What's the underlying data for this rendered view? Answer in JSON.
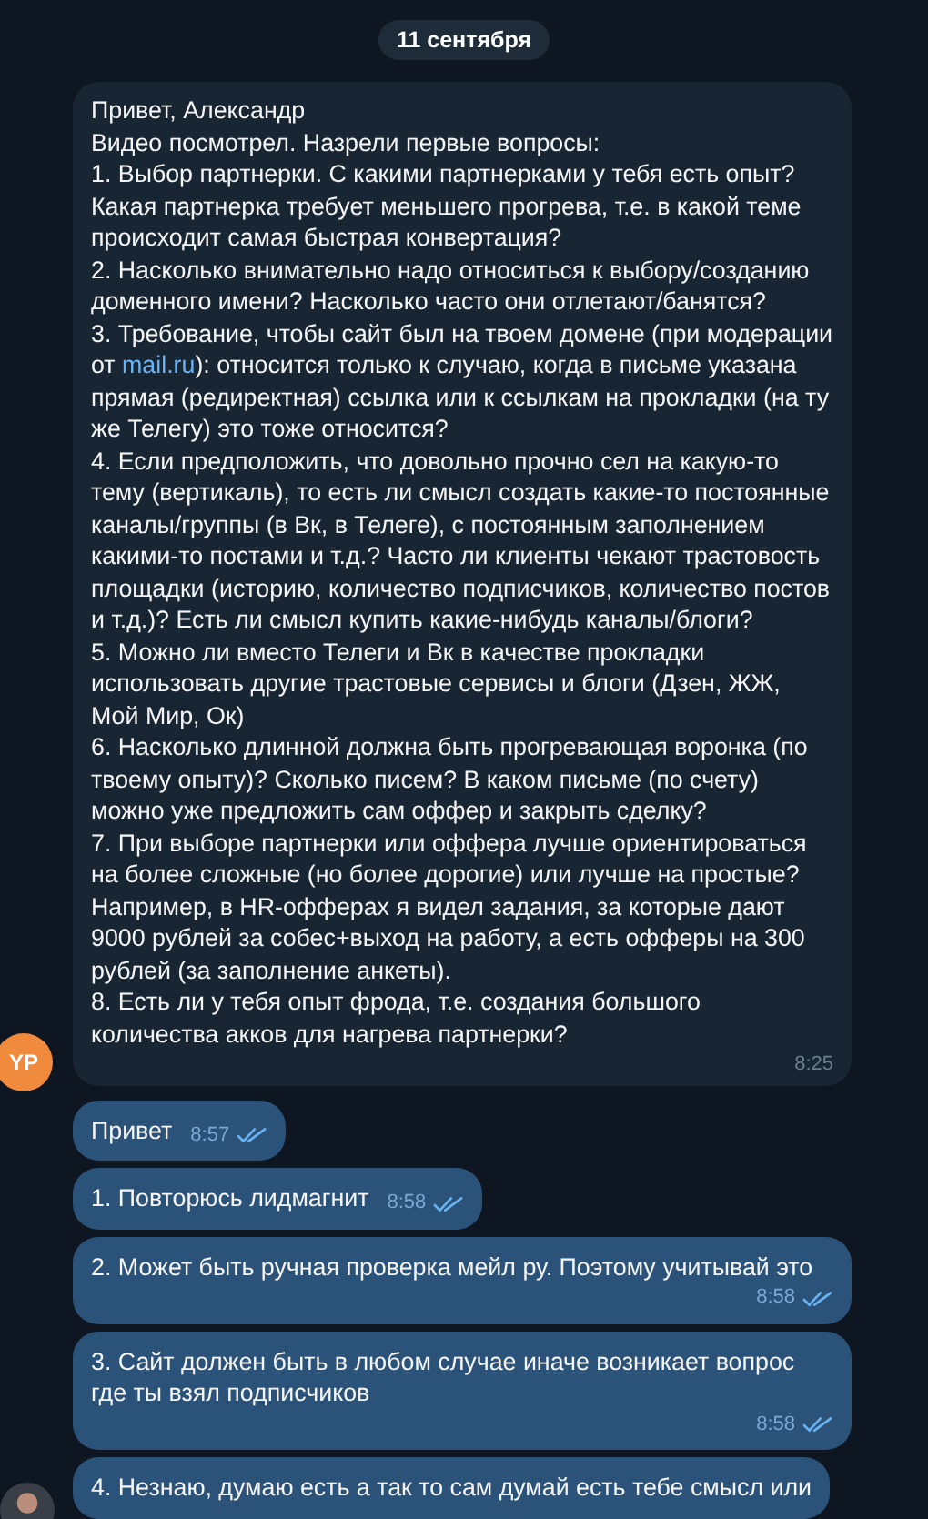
{
  "date": "11 сентября",
  "incoming": {
    "avatar": "YP",
    "time": "8:25",
    "parts": [
      {
        "kind": "text",
        "text": "Привет, Александр\nВидео посмотрел. Назрели первые вопросы:\n1. Выбор партнерки. С какими партнерками у тебя есть опыт? Какая партнерка требует меньшего прогрева, т.е. в какой теме происходит самая быстрая конвертация?\n2. Насколько внимательно надо относиться к выбору/созданию доменного имени? Насколько часто они отлетают/банятся?\n3. Требование, чтобы сайт был на твоем домене (при модерации от "
      },
      {
        "kind": "link",
        "text": "mail.ru"
      },
      {
        "kind": "text",
        "text": "): относится только к случаю, когда в письме указана прямая (редиректная) ссылка или к ссылкам на прокладки (на ту же Телегу) это тоже относится?\n4. Если предположить, что довольно прочно сел на какую-то тему (вертикаль), то есть ли смысл создать какие-то постоянные каналы/группы (в Вк, в Телеге), с постоянным заполнением какими-то постами и т.д.? Часто ли клиенты чекают трастовость площадки (историю, количество подписчиков, количество постов и т.д.)? Есть ли смысл купить какие-нибудь каналы/блоги?\n5. Можно ли вместо Телеги и Вк в качестве прокладки использовать другие трастовые сервисы и блоги (Дзен, ЖЖ, Мой Мир, Ок)\n6. Насколько длинной должна быть прогревающая воронка (по твоему опыту)? Сколько писем? В каком письме (по счету) можно уже предложить сам оффер и закрыть сделку?\n7. При выборе партнерки или оффера лучше ориентироваться на более сложные (но более дорогие) или лучше на простые? Например, в HR-офферах я видел задания, за которые дают 9000 рублей за собес+выход на работу, а есть офферы на 300 рублей (за заполнение анкеты).\n8. Есть ли у тебя опыт фрода, т.е. создания большого количества акков для нагрева партнерки?"
      }
    ]
  },
  "outgoing": [
    {
      "text": "Привет",
      "time": "8:57",
      "read": true
    },
    {
      "text": "1. Повторюсь лидмагнит",
      "time": "8:58",
      "read": true
    },
    {
      "text": "2. Может быть ручная проверка мейл ру. Поэтому учитывай это",
      "time": "8:58",
      "read": true
    },
    {
      "text": "3. Сайт должен быть в любом случае иначе возникает вопрос где ты взял подписчиков",
      "time": "8:58",
      "read": true
    },
    {
      "text": "4. Незнаю, думаю есть а так то сам думай есть тебе смысл или"
    }
  ]
}
